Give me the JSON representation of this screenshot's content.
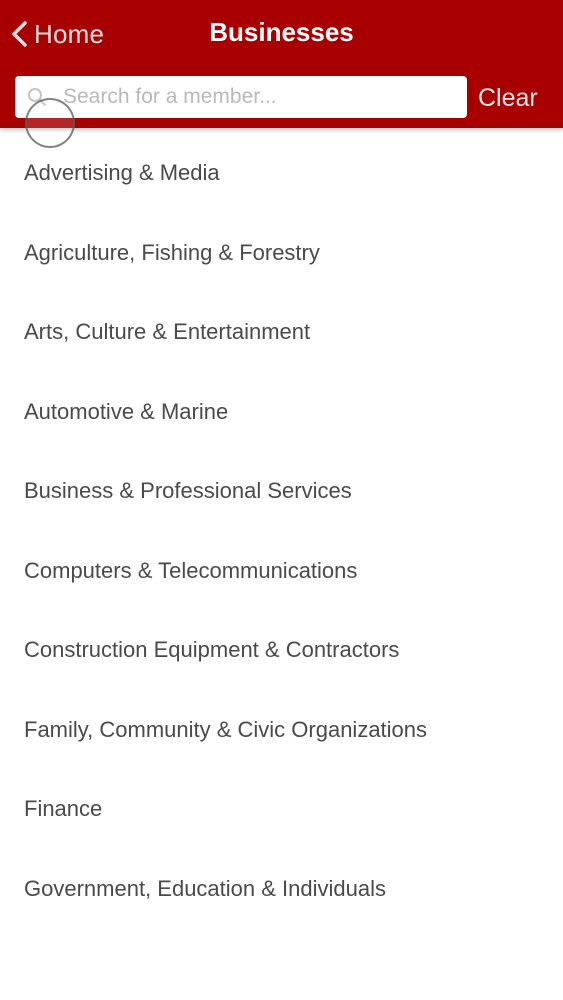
{
  "header": {
    "back_label": "Home",
    "title": "Businesses",
    "background_color": "#a80000",
    "back_icon": "chevron-left-icon"
  },
  "search": {
    "placeholder": "Search for a member...",
    "value": "",
    "icon": "search-icon",
    "clear_label": "Clear"
  },
  "categories": [
    {
      "label": "Advertising & Media"
    },
    {
      "label": "Agriculture, Fishing & Forestry"
    },
    {
      "label": "Arts, Culture & Entertainment"
    },
    {
      "label": "Automotive & Marine"
    },
    {
      "label": "Business & Professional Services"
    },
    {
      "label": "Computers & Telecommunications"
    },
    {
      "label": "Construction Equipment & Contractors"
    },
    {
      "label": "Family, Community & Civic Organizations"
    },
    {
      "label": "Finance"
    },
    {
      "label": "Government, Education & Individuals"
    }
  ]
}
